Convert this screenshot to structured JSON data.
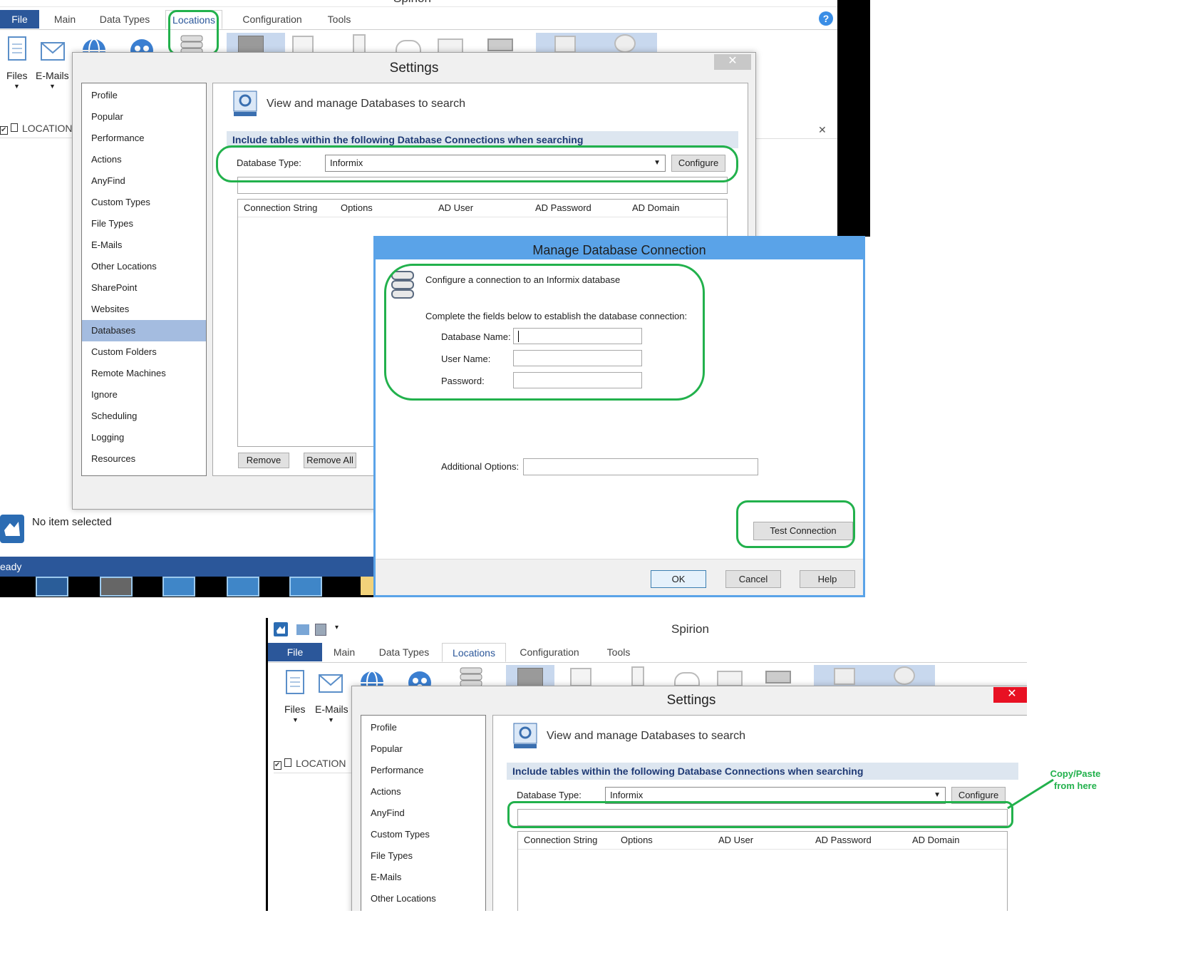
{
  "app": {
    "title": "Spirion",
    "tabs": [
      "File",
      "Main",
      "Data Types",
      "Locations",
      "Configuration",
      "Tools"
    ],
    "active_tab": "Locations",
    "ribbon_labels": {
      "files": "Files",
      "emails": "E-Mails"
    },
    "location_header": "LOCATION",
    "status_text": "No item selected",
    "statusbar_text": "eady",
    "help_glyph": "?"
  },
  "settings": {
    "title": "Settings",
    "close_glyph": "✕",
    "nav_items": [
      "Profile",
      "Popular",
      "Performance",
      "Actions",
      "AnyFind",
      "Custom Types",
      "File Types",
      "E-Mails",
      "Other Locations",
      "SharePoint",
      "Websites",
      "Databases",
      "Custom Folders",
      "Remote Machines",
      "Ignore",
      "Scheduling",
      "Logging",
      "Resources"
    ],
    "selected_nav": "Databases",
    "heading": "View and manage Databases to search",
    "section_title": "Include tables within the following Database Connections when searching",
    "db_type_label": "Database Type:",
    "db_type_value": "Informix",
    "configure_label": "Configure",
    "columns": [
      "Connection String",
      "Options",
      "AD User",
      "AD Password",
      "AD Domain"
    ],
    "remove_label": "Remove",
    "remove_all_label": "Remove All"
  },
  "manage_dialog": {
    "title": "Manage Database Connection",
    "intro": "Configure a connection to an Informix database",
    "instructions": "Complete the fields below to establish the database connection:",
    "fields": [
      {
        "label": "Database Name:",
        "value": ""
      },
      {
        "label": "User Name:",
        "value": ""
      },
      {
        "label": "Password:",
        "value": ""
      }
    ],
    "additional_options_label": "Additional Options:",
    "test_connection_label": "Test Connection",
    "ok_label": "OK",
    "cancel_label": "Cancel",
    "help_label": "Help"
  },
  "annotation": {
    "line1": "Copy/Paste",
    "line2": "from here",
    "color": "#22b14c"
  },
  "colors": {
    "accent": "#2b579a",
    "dialog_title": "#5aa3e8",
    "nav_selected": "#a4bce0",
    "close_red": "#e81123",
    "highlight": "#22b14c"
  }
}
